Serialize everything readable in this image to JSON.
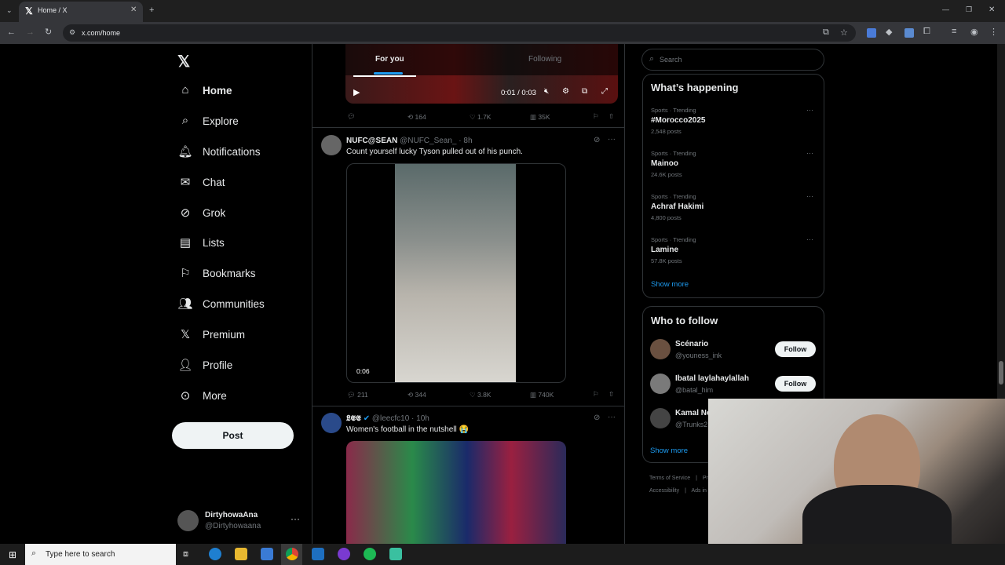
{
  "browser": {
    "tab_title": "Home / X",
    "url": "x.com/home"
  },
  "nav": {
    "items": [
      {
        "label": "Home",
        "icon": "home-icon"
      },
      {
        "label": "Explore",
        "icon": "search-icon"
      },
      {
        "label": "Notifications",
        "icon": "bell-icon"
      },
      {
        "label": "Chat",
        "icon": "mail-icon"
      },
      {
        "label": "Grok",
        "icon": "grok-icon"
      },
      {
        "label": "Lists",
        "icon": "list-icon"
      },
      {
        "label": "Bookmarks",
        "icon": "bookmark-icon"
      },
      {
        "label": "Communities",
        "icon": "people-icon"
      },
      {
        "label": "Premium",
        "icon": "x-icon"
      },
      {
        "label": "Profile",
        "icon": "person-icon"
      },
      {
        "label": "More",
        "icon": "more-circle-icon"
      }
    ],
    "post_label": "Post",
    "account_name": "DirtyhowaAna",
    "account_handle": "@Dirtyhowaana"
  },
  "feed": {
    "tabs": [
      "For you",
      "Following"
    ],
    "video1": {
      "time": "0:01 / 0:03",
      "replies": "",
      "reposts": "164",
      "likes": "1.7K",
      "views": "35K"
    },
    "tweet1": {
      "name": "NUFC@SEAN",
      "handle": "@NUFC_Sean_",
      "time": "· 8h",
      "text": "Count yourself lucky Tyson pulled out of his punch.",
      "video_time": "0:06",
      "replies": "211",
      "reposts": "344",
      "likes": "3.8K",
      "views": "740K"
    },
    "tweet2": {
      "name": "𝕷𝕰𝕰",
      "handle": "@leecfc10",
      "time": "· 10h",
      "text": "Women's football in the nutshell 😭"
    }
  },
  "sidebar": {
    "search_placeholder": "Search",
    "happening_title": "What’s happening",
    "trends": [
      {
        "meta": "Sports · Trending",
        "name": "#Morocco2025",
        "posts": "2,548 posts"
      },
      {
        "meta": "Sports · Trending",
        "name": "Mainoo",
        "posts": "24.6K posts"
      },
      {
        "meta": "Sports · Trending",
        "name": "Achraf Hakimi",
        "posts": "4,800 posts"
      },
      {
        "meta": "Sports · Trending",
        "name": "Lamine",
        "posts": "57.8K posts"
      }
    ],
    "show_more": "Show more",
    "who_to_follow_title": "Who to follow",
    "follow": [
      {
        "name": "Scénario",
        "handle": "@youness_ink",
        "button": "Follow"
      },
      {
        "name": "Ibatal laylahaylallah",
        "handle": "@batal_him",
        "button": "Follow"
      },
      {
        "name": "Kamal Ne",
        "handle": "@Trunks2"
      }
    ],
    "show_more_2": "Show more",
    "footer": [
      "Terms of Service",
      "Pr",
      "Accessibility",
      "Ads in"
    ]
  },
  "taskbar": {
    "search_placeholder": "Type here to search"
  },
  "colors": {
    "background": "#000000",
    "accent": "#1d9bf0",
    "border": "#2f3336",
    "muted": "#71767b"
  }
}
